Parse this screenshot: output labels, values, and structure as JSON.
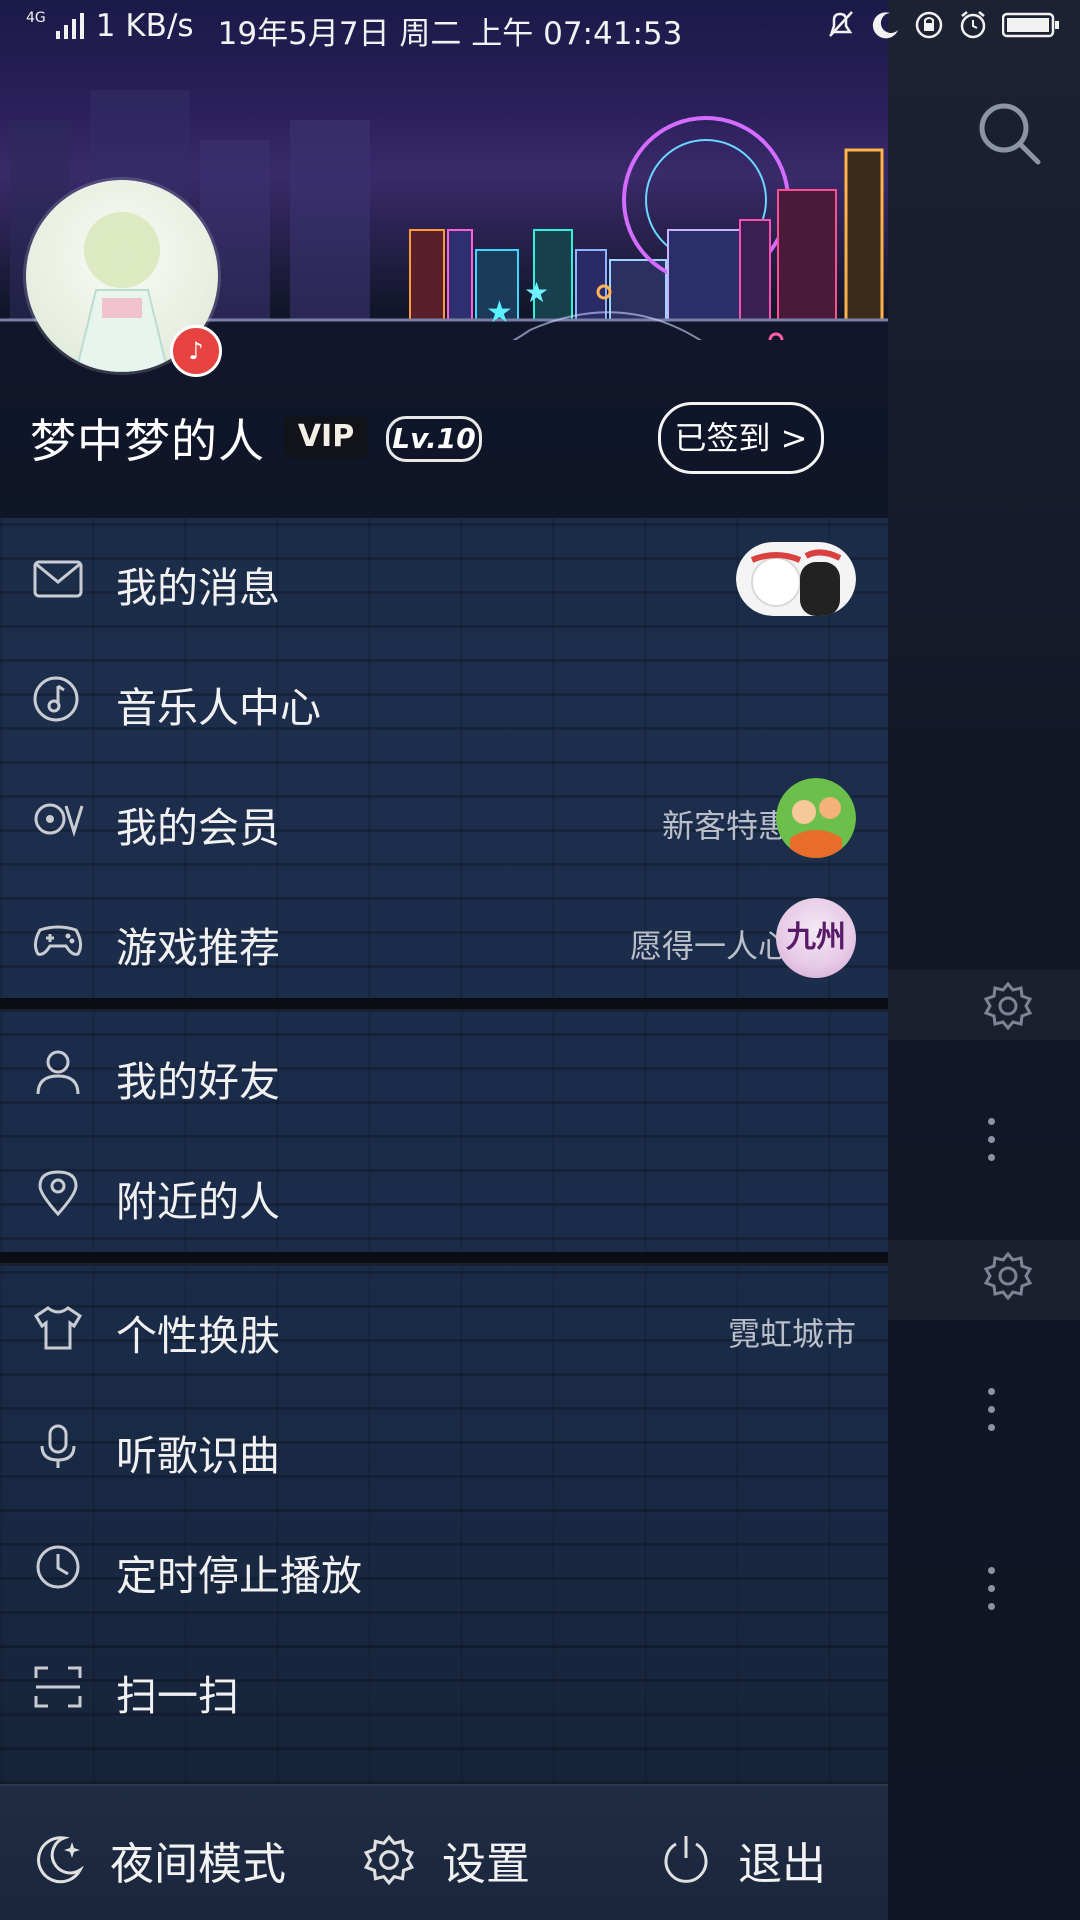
{
  "status_bar": {
    "network": "4G",
    "speed": "1 KB/s",
    "datetime": "19年5月7日 周二 上午 07:41:53"
  },
  "profile": {
    "name": "梦中梦的人",
    "vip_badge": "VIP",
    "level": "Lv.10",
    "signin_label": "已签到 >"
  },
  "menu_group1": [
    {
      "label": "我的消息",
      "extra": ""
    },
    {
      "label": "音乐人中心",
      "extra": ""
    },
    {
      "label": "我的会员",
      "extra": "新客特惠"
    },
    {
      "label": "游戏推荐",
      "extra": "愿得一人心"
    }
  ],
  "menu_group2": [
    {
      "label": "我的好友"
    },
    {
      "label": "附近的人"
    }
  ],
  "menu_group3": [
    {
      "label": "个性换肤",
      "extra": "霓虹城市"
    },
    {
      "label": "听歌识曲"
    },
    {
      "label": "定时停止播放"
    },
    {
      "label": "扫一扫"
    }
  ],
  "game_thumb_text": "九州",
  "bottom_bar": {
    "night_mode": "夜间模式",
    "settings": "设置",
    "logout": "退出"
  },
  "colors": {
    "accent_red": "#e64340",
    "text": "#f1f1f1",
    "subtext": "#b9bec8"
  }
}
